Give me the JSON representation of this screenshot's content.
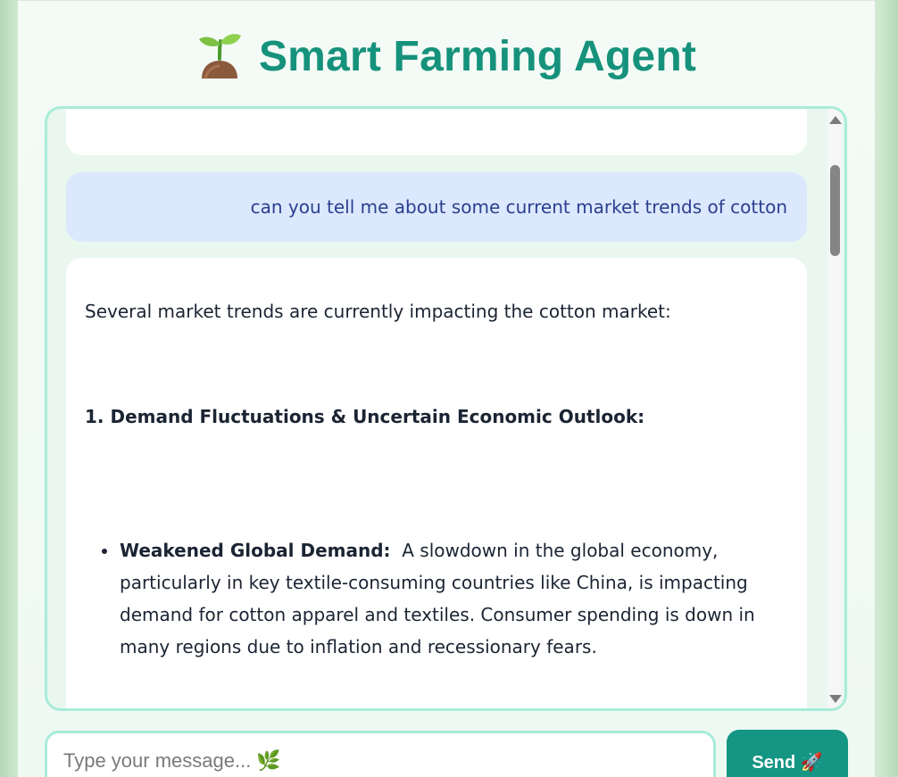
{
  "header": {
    "title": "Smart Farming Agent",
    "logo_icon": "seedling-icon"
  },
  "chat": {
    "user_message": "can you tell me about some current market trends of cotton",
    "bot_message": {
      "intro": "Several market trends are currently impacting the cotton market:",
      "heading": "1. Demand Fluctuations & Uncertain Economic Outlook:",
      "bullets": [
        {
          "title": "Weakened Global Demand:",
          "text": "A slowdown in the global economy, particularly in key textile-consuming countries like China, is impacting demand for cotton apparel and textiles.  Consumer spending is down in many regions due to inflation and recessionary fears."
        }
      ]
    }
  },
  "composer": {
    "placeholder": "Type your message... 🌿",
    "send_label": "Send 🚀"
  },
  "colors": {
    "accent": "#16927c",
    "send_button": "#159584",
    "chat_border": "#a8ecd9",
    "user_bubble": "#dbe8fd"
  }
}
